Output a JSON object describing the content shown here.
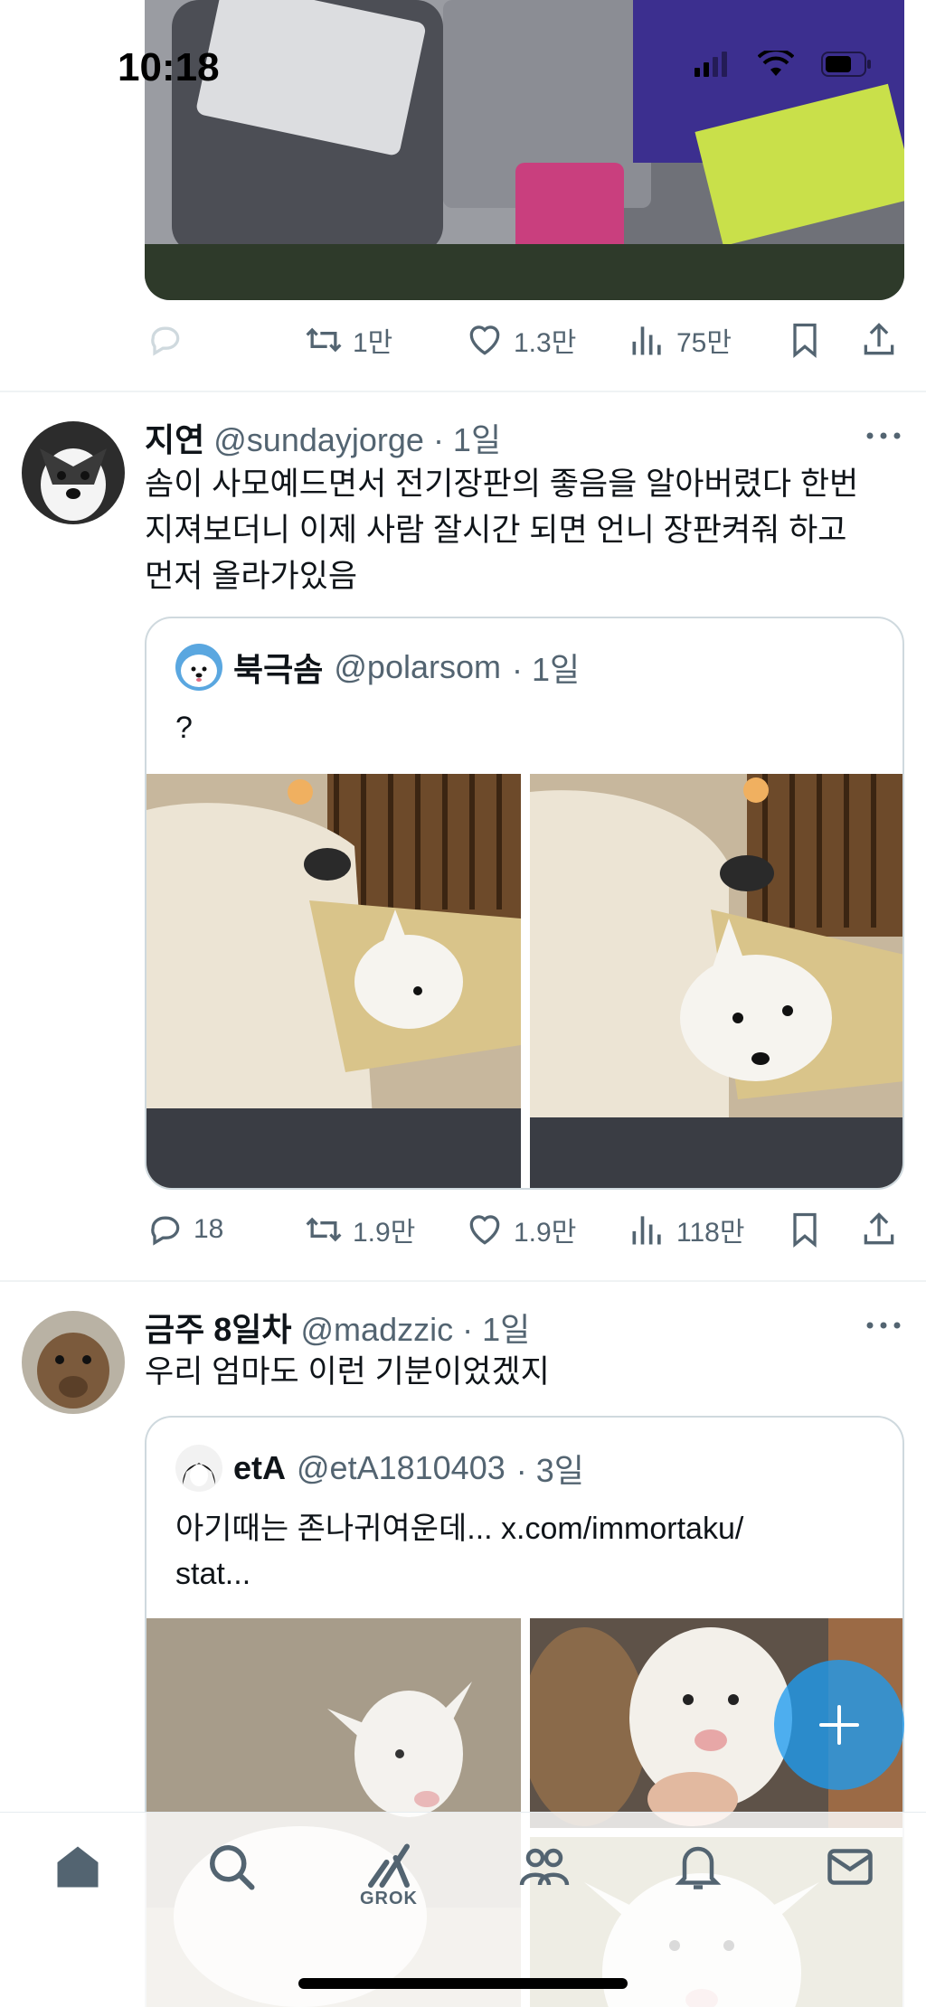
{
  "status_bar": {
    "time": "10:18"
  },
  "tweets": [
    {
      "stats": {
        "retweets": "1만",
        "likes": "1.3만",
        "views": "75만"
      }
    },
    {
      "name": "지연",
      "handle": "@sundayjorge",
      "time": "· 1일",
      "text": "솜이 사모예드면서 전기장판의 좋음을 알아버렸다 한번\n지져보더니 이제 사람 잘시간 되면 언니 장판켜줘 하고\n먼저 올라가있음",
      "quote": {
        "name": "북극솜",
        "handle": "@polarsom",
        "time": "· 1일",
        "text": "?"
      },
      "stats": {
        "replies": "18",
        "retweets": "1.9만",
        "likes": "1.9만",
        "views": "118만"
      }
    },
    {
      "name": "금주 8일차",
      "handle": "@madzzic",
      "time": "· 1일",
      "text": "우리 엄마도 이런 기분이었겠지",
      "quote": {
        "name": "etA",
        "handle": "@etA1810403",
        "time": "· 3일",
        "text": "아기때는 존나귀여운데... x.com/immortaku/\nstat..."
      }
    }
  ],
  "tabbar": {
    "grok_label": "GROK"
  },
  "colors": {
    "accent": "#1d9bf0",
    "secondary_text": "#536471",
    "border": "#cfd9de"
  }
}
